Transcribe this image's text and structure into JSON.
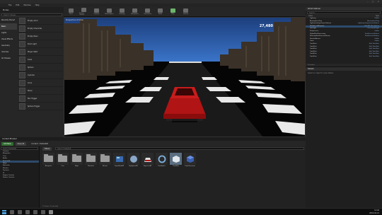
{
  "window": {
    "title": "Unreal Editor",
    "controls": [
      "–",
      "□",
      "×"
    ]
  },
  "menu": [
    "File",
    "Edit",
    "Window",
    "Help"
  ],
  "modes": {
    "label": "Modes"
  },
  "place": {
    "search_placeholder": "Search Classes",
    "categories": [
      "Recently Placed",
      "Basic",
      "Lights",
      "Visual Effects",
      "Geometry",
      "Volumes",
      "All Classes"
    ],
    "active_category_index": 1,
    "items": [
      "Empty Actor",
      "Empty Character",
      "Empty Pawn",
      "Point Light",
      "Player Start",
      "Cube",
      "Sphere",
      "Cylinder",
      "Cone",
      "Plane",
      "Box Trigger",
      "Sphere Trigger"
    ]
  },
  "toolbar": {
    "buttons": [
      "Save",
      "Source Control",
      "Content",
      "Marketplace",
      "Settings",
      "Blueprints",
      "Cinematics",
      "Build",
      "Play",
      "Launch"
    ]
  },
  "viewport": {
    "overlay": "Perspective  Lit  Show",
    "score": "27,480"
  },
  "outliner": {
    "title": "World Outliner",
    "search_placeholder": "Search...",
    "col_label": "Label",
    "col_type": "Type",
    "rows": [
      {
        "label": "Lighting",
        "type": "Folder"
      },
      {
        "label": "AtmosphericFog",
        "type": "AtmosphericFog"
      },
      {
        "label": "LightmassImportanceVolume",
        "type": "LightmassImportanceVolume"
      },
      {
        "label": "SkySphereBlueprint",
        "type": "Edit BP_Sky_Sphere"
      },
      {
        "label": "SunLight",
        "type": "DirectionalLight"
      },
      {
        "label": "Postprocess",
        "type": "Folder"
      },
      {
        "label": "GlobalPostProcessing",
        "type": "PostProcessVolume"
      },
      {
        "label": "MinimapPostProcessVolume",
        "type": "PostProcessVolume"
      },
      {
        "label": "SkeletalActors",
        "type": "Folder"
      },
      {
        "label": "Track",
        "type": "Folder"
      },
      {
        "label": "TrackPart",
        "type": "Edit TrackPart"
      },
      {
        "label": "TrackPart",
        "type": "Edit TrackPart"
      },
      {
        "label": "TrackPart",
        "type": "Edit TrackPart"
      },
      {
        "label": "TrackPart",
        "type": "Edit TrackPart"
      },
      {
        "label": "TrackPart",
        "type": "Edit TrackPart"
      },
      {
        "label": "TrackPart",
        "type": "Edit TrackPart"
      }
    ],
    "selected_row": 3,
    "footer": "51 actors"
  },
  "details": {
    "title": "Details",
    "hint": "Select an object to view details."
  },
  "content_browser": {
    "tab": "Content Browser",
    "add_new": "Add New",
    "save_all": "Save All",
    "breadcrumb": "Content  ›  FastestGit",
    "filters": "Filters",
    "search_placeholder": "Search FastestGit",
    "tree": [
      "Content",
      "Blueprints",
      "Cars",
      "Audio",
      "FastestGit",
      "Maps",
      "Materials",
      "Meshes",
      "Textures",
      "UI",
      "Engine Content",
      "Starter Content"
    ],
    "tree_selected": 4,
    "assets": [
      {
        "name": "Blueprints",
        "kind": "folder"
      },
      {
        "name": "Cars",
        "kind": "folder"
      },
      {
        "name": "Maps",
        "kind": "folder"
      },
      {
        "name": "Materials",
        "kind": "folder"
      },
      {
        "name": "Meshes",
        "kind": "folder"
      },
      {
        "name": "GameModeBP",
        "kind": "blueprint"
      },
      {
        "name": "SkySphereBP",
        "kind": "sphere"
      },
      {
        "name": "PlayerCarBP",
        "kind": "car"
      },
      {
        "name": "TrackSpline",
        "kind": "ring"
      },
      {
        "name": "TrackPart",
        "kind": "cube",
        "selected": true
      },
      {
        "name": "TrackGenerator",
        "kind": "box"
      }
    ],
    "status": "11 items (1 selected)"
  },
  "taskbar": {
    "time": "12:46",
    "date": "2016-04-14"
  }
}
